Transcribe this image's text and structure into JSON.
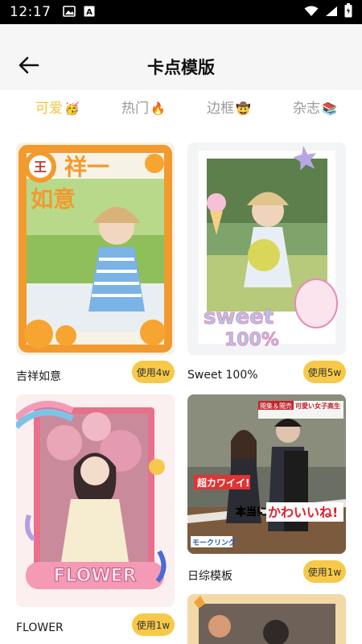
{
  "status_bar": {
    "time": "12:17",
    "icons": [
      "image-icon",
      "keyboard-a-icon",
      "wifi-icon",
      "cell-signal-icon",
      "battery-icon"
    ]
  },
  "header": {
    "title": "卡点模版",
    "back_icon": "arrow-left-icon"
  },
  "tabs": [
    {
      "label": "可爱",
      "emoji": "🥳",
      "active": true
    },
    {
      "label": "热门",
      "emoji": "🔥",
      "active": false
    },
    {
      "label": "边框",
      "emoji": "🤠",
      "active": false
    },
    {
      "label": "杂志",
      "emoji": "📚",
      "active": false
    }
  ],
  "templates": [
    {
      "title": "吉祥如意",
      "use_label": "使用4w",
      "overlay_lines": [
        "祥一",
        "如意",
        "王"
      ]
    },
    {
      "title": "Sweet 100%",
      "use_label": "使用5w",
      "overlay_lines": [
        "sweet",
        "100%"
      ]
    },
    {
      "title": "FLOWER",
      "use_label": "使用1w",
      "overlay_lines": [
        "FLOWER"
      ]
    },
    {
      "title": "日综模板",
      "use_label": "使用1w",
      "overlay_lines": [
        "閲集＆閲売",
        "可愛い女子高生",
        "超カワイイ!",
        "本当に",
        "かわいいね!",
        "モークリング"
      ]
    }
  ],
  "colors": {
    "accent": "#f7c948",
    "active_tab": "#f4c542",
    "inactive_tab": "#9a9a9a",
    "header_bg": "#f6f6f6"
  }
}
